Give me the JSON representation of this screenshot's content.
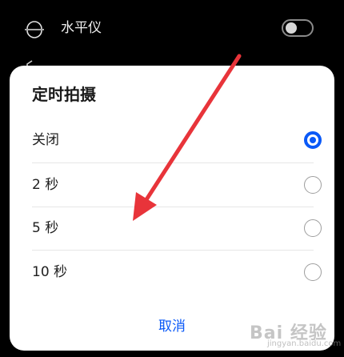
{
  "background": {
    "setting_label": "水平仪",
    "setting_icon": "level-icon",
    "toggle_on": false,
    "peek_icon": "camera-icon"
  },
  "dialog": {
    "title": "定时拍摄",
    "options": [
      {
        "label": "关闭",
        "selected": true
      },
      {
        "label": "2 秒",
        "selected": false
      },
      {
        "label": "5 秒",
        "selected": false
      },
      {
        "label": "10 秒",
        "selected": false
      }
    ],
    "cancel_label": "取消"
  },
  "annotation": {
    "arrow_color": "#e8343a"
  },
  "watermark": {
    "text": "Bai 经验",
    "sub": "jingyan.baidu.com"
  },
  "colors": {
    "accent": "#0a59f7",
    "background": "#000000",
    "dialog": "#ffffff"
  }
}
